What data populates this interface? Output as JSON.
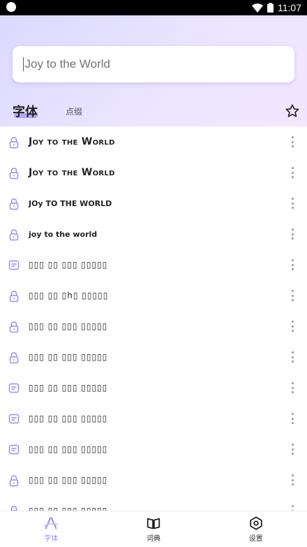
{
  "status_bar": {
    "time": "11:07"
  },
  "search": {
    "value": "",
    "placeholder": "Joy to the World"
  },
  "tabs": {
    "fonts": "字体",
    "decor": "点缀"
  },
  "font_list": [
    {
      "text": "Joy to the World",
      "icon": "lock-icon"
    },
    {
      "text": "Joy to the World",
      "icon": "lock-icon"
    },
    {
      "text": "JOy TO THE WORLD",
      "icon": "lock-icon"
    },
    {
      "text": "joy to the world",
      "icon": "lock-icon"
    },
    {
      "text": "▯▯▯ ▯▯ ▯▯▯ ▯▯▯▯▯",
      "icon": "note-icon"
    },
    {
      "text": "▯▯▯ ▯▯ ▯h▯ ▯▯▯▯▯",
      "icon": "lock-icon"
    },
    {
      "text": "▯▯▯ ▯▯ ▯▯▯ ▯▯▯▯▯",
      "icon": "lock-icon"
    },
    {
      "text": "▯▯▯ ▯▯ ▯▯▯ ▯▯▯▯▯",
      "icon": "lock-icon"
    },
    {
      "text": "▯▯▯ ▯▯ ▯▯▯ ▯▯▯▯▯",
      "icon": "note-icon"
    },
    {
      "text": "▯▯▯ ▯▯ ▯▯▯ ▯▯▯▯▯",
      "icon": "note-icon"
    },
    {
      "text": "▯▯▯ ▯▯ ▯▯▯ ▯▯▯▯▯",
      "icon": "note-icon"
    },
    {
      "text": "▯▯▯ ▯▯ ▯▯▯ ▯▯▯▯▯",
      "icon": "lock-icon"
    },
    {
      "text": "▯▯▯ ▯▯ ▯▯▯ ▯▯▯▯▯",
      "icon": "lock-icon"
    }
  ],
  "bottom_nav": [
    {
      "label": "字体",
      "icon": "font-icon",
      "active": true
    },
    {
      "label": "词典",
      "icon": "book-icon",
      "active": false
    },
    {
      "label": "设置",
      "icon": "settings-icon",
      "active": false
    }
  ],
  "colors": {
    "accent": "#9c8cf0",
    "header_start": "#dcd9ff",
    "header_end": "#f3e6ff"
  }
}
